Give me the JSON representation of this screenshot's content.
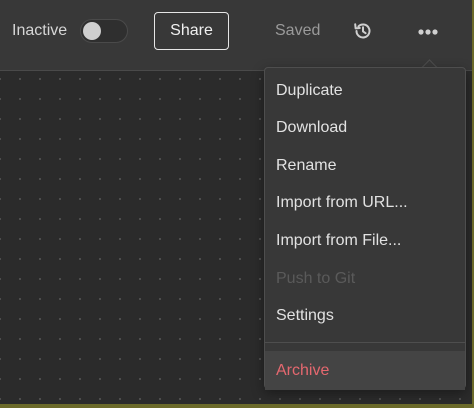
{
  "toolbar": {
    "status_label": "Inactive",
    "toggle_active": false,
    "share_label": "Share",
    "save_status": "Saved",
    "history_icon": "history-icon",
    "more_icon": "more-horizontal-icon"
  },
  "menu": {
    "items": [
      {
        "label": "Duplicate",
        "disabled": false
      },
      {
        "label": "Download",
        "disabled": false
      },
      {
        "label": "Rename",
        "disabled": false
      },
      {
        "label": "Import from URL...",
        "disabled": false
      },
      {
        "label": "Import from File...",
        "disabled": false
      },
      {
        "label": "Push to Git",
        "disabled": true
      },
      {
        "label": "Settings",
        "disabled": false
      }
    ],
    "archive_label": "Archive"
  },
  "colors": {
    "background": "#2b2b2b",
    "toolbar": "#383838",
    "danger": "#e5686f",
    "disabled_text": "#5a5a5a"
  }
}
